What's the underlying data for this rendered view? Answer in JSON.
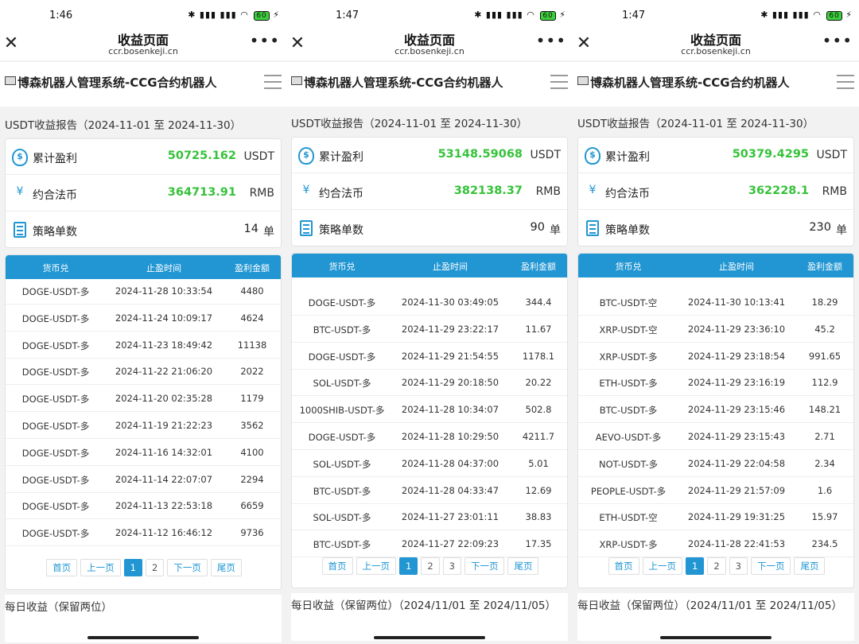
{
  "accent_color": "#2196d3",
  "profit_color": "#36c23a",
  "panels": [
    {
      "status": {
        "time": "1:46",
        "battery": "60"
      },
      "browser": {
        "title": "收益页面",
        "url": "ccr.bosenkeji.cn"
      },
      "app_title": "博森机器人管理系统-CCG合约机器人",
      "report_title": "USDT收益报告（2024-11-01 至 2024-11-30）",
      "summary": {
        "profit_label": "累计盈利",
        "profit_value": "50725.162",
        "profit_unit": "USDT",
        "fiat_label": "约合法币",
        "fiat_value": "364713.91",
        "fiat_unit": "RMB",
        "orders_label": "策略单数",
        "orders_value": "14",
        "orders_unit": "单"
      },
      "table": {
        "headers": [
          "货币兑",
          "止盈时间",
          "盈利金额"
        ],
        "rows": [
          [
            "DOGE-USDT-多",
            "2024-11-28 10:33:54",
            "4480"
          ],
          [
            "DOGE-USDT-多",
            "2024-11-24 10:09:17",
            "4624"
          ],
          [
            "DOGE-USDT-多",
            "2024-11-23 18:49:42",
            "11138"
          ],
          [
            "DOGE-USDT-多",
            "2024-11-22 21:06:20",
            "2022"
          ],
          [
            "DOGE-USDT-多",
            "2024-11-20 02:35:28",
            "1179"
          ],
          [
            "DOGE-USDT-多",
            "2024-11-19 21:22:23",
            "3562"
          ],
          [
            "DOGE-USDT-多",
            "2024-11-16 14:32:01",
            "4100"
          ],
          [
            "DOGE-USDT-多",
            "2024-11-14 22:07:07",
            "2294"
          ],
          [
            "DOGE-USDT-多",
            "2024-11-13 22:53:18",
            "6659"
          ],
          [
            "DOGE-USDT-多",
            "2024-11-12 16:46:12",
            "9736"
          ]
        ]
      },
      "pager": {
        "first": "首页",
        "prev": "上一页",
        "pages": [
          "1",
          "2"
        ],
        "current": "1",
        "next": "下一页",
        "last": "尾页"
      },
      "daily_title": "每日收益（保留两位）"
    },
    {
      "status": {
        "time": "1:47",
        "battery": "60"
      },
      "browser": {
        "title": "收益页面",
        "url": "ccr.bosenkeji.cn"
      },
      "app_title": "博森机器人管理系统-CCG合约机器人",
      "report_title": "USDT收益报告（2024-11-01 至 2024-11-30）",
      "summary": {
        "profit_label": "累计盈利",
        "profit_value": "53148.59068",
        "profit_unit": "USDT",
        "fiat_label": "约合法币",
        "fiat_value": "382138.37",
        "fiat_unit": "RMB",
        "orders_label": "策略单数",
        "orders_value": "90",
        "orders_unit": "单"
      },
      "table": {
        "headers": [
          "货币兑",
          "止盈时间",
          "盈利金额"
        ],
        "rows": [
          [
            "DOGE-USDT-多",
            "2024-11-30 03:49:05",
            "344.4"
          ],
          [
            "BTC-USDT-多",
            "2024-11-29 23:22:17",
            "11.67"
          ],
          [
            "DOGE-USDT-多",
            "2024-11-29 21:54:55",
            "1178.1"
          ],
          [
            "SOL-USDT-多",
            "2024-11-29 20:18:50",
            "20.22"
          ],
          [
            "1000SHIB-USDT-多",
            "2024-11-28 10:34:07",
            "502.8"
          ],
          [
            "DOGE-USDT-多",
            "2024-11-28 10:29:50",
            "4211.7"
          ],
          [
            "SOL-USDT-多",
            "2024-11-28 04:37:00",
            "5.01"
          ],
          [
            "BTC-USDT-多",
            "2024-11-28 04:33:47",
            "12.69"
          ],
          [
            "SOL-USDT-多",
            "2024-11-27 23:01:11",
            "38.83"
          ],
          [
            "BTC-USDT-多",
            "2024-11-27 22:09:23",
            "17.35"
          ]
        ]
      },
      "pager": {
        "first": "首页",
        "prev": "上一页",
        "pages": [
          "1",
          "2",
          "3"
        ],
        "current": "1",
        "next": "下一页",
        "last": "尾页"
      },
      "daily_title": "每日收益（保留两位）（2024/11/01 至 2024/11/05）"
    },
    {
      "status": {
        "time": "1:47",
        "battery": "60"
      },
      "browser": {
        "title": "收益页面",
        "url": "ccr.bosenkeji.cn"
      },
      "app_title": "博森机器人管理系统-CCG合约机器人",
      "report_title": "USDT收益报告（2024-11-01 至 2024-11-30）",
      "summary": {
        "profit_label": "累计盈利",
        "profit_value": "50379.4295",
        "profit_unit": "USDT",
        "fiat_label": "约合法币",
        "fiat_value": "362228.1",
        "fiat_unit": "RMB",
        "orders_label": "策略单数",
        "orders_value": "230",
        "orders_unit": "单"
      },
      "table": {
        "headers": [
          "货币兑",
          "止盈时间",
          "盈利金额"
        ],
        "rows": [
          [
            "BTC-USDT-空",
            "2024-11-30 10:13:41",
            "18.29"
          ],
          [
            "XRP-USDT-空",
            "2024-11-29 23:36:10",
            "45.2"
          ],
          [
            "XRP-USDT-多",
            "2024-11-29 23:18:54",
            "991.65"
          ],
          [
            "ETH-USDT-多",
            "2024-11-29 23:16:19",
            "112.9"
          ],
          [
            "BTC-USDT-多",
            "2024-11-29 23:15:46",
            "148.21"
          ],
          [
            "AEVO-USDT-多",
            "2024-11-29 23:15:43",
            "2.71"
          ],
          [
            "NOT-USDT-多",
            "2024-11-29 22:04:58",
            "2.34"
          ],
          [
            "PEOPLE-USDT-多",
            "2024-11-29 21:57:09",
            "1.6"
          ],
          [
            "ETH-USDT-空",
            "2024-11-29 19:31:25",
            "15.97"
          ],
          [
            "XRP-USDT-多",
            "2024-11-28 22:41:53",
            "234.5"
          ]
        ]
      },
      "pager": {
        "first": "首页",
        "prev": "上一页",
        "pages": [
          "1",
          "2",
          "3"
        ],
        "current": "1",
        "next": "下一页",
        "last": "尾页"
      },
      "daily_title": "每日收益（保留两位）（2024/11/01 至 2024/11/05）"
    }
  ]
}
